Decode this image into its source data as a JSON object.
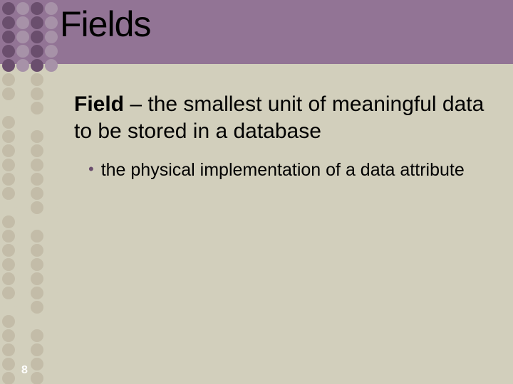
{
  "header": {
    "title": "Fields"
  },
  "content": {
    "term": "Field",
    "definition_sep": " – ",
    "definition": "the smallest unit of meaningful data to be stored in a database",
    "bullets": [
      "the physical implementation of a data attribute"
    ]
  },
  "page_number": "8"
}
